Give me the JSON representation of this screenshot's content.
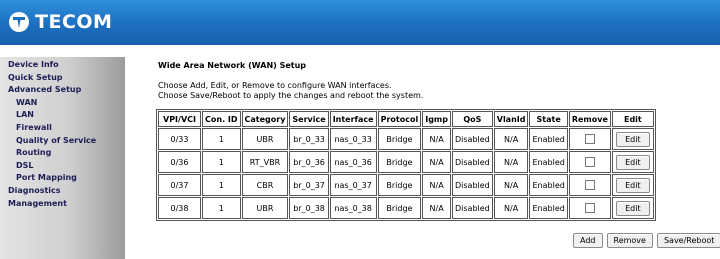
{
  "brand": {
    "name": "TECOM",
    "logo_icon": "tecom-logo-icon",
    "header_color": "#1d6fc0"
  },
  "sidebar": {
    "items": [
      {
        "label": "Device Info",
        "level": 1
      },
      {
        "label": "Quick Setup",
        "level": 1
      },
      {
        "label": "Advanced Setup",
        "level": 1
      },
      {
        "label": "WAN",
        "level": 2
      },
      {
        "label": "LAN",
        "level": 2
      },
      {
        "label": "Firewall",
        "level": 2
      },
      {
        "label": "Quality of Service",
        "level": 2
      },
      {
        "label": "Routing",
        "level": 2
      },
      {
        "label": "DSL",
        "level": 2
      },
      {
        "label": "Port Mapping",
        "level": 2
      },
      {
        "label": "Diagnostics",
        "level": 1
      },
      {
        "label": "Management",
        "level": 1
      }
    ]
  },
  "main": {
    "title": "Wide Area Network (WAN) Setup",
    "desc_line1": "Choose Add, Edit, or Remove to configure WAN interfaces.",
    "desc_line2": "Choose Save/Reboot to apply the changes and reboot the system.",
    "table": {
      "headers": [
        "VPI/VCI",
        "Con. ID",
        "Category",
        "Service",
        "Interface",
        "Protocol",
        "Igmp",
        "QoS",
        "VlanId",
        "State",
        "Remove",
        "Edit"
      ],
      "rows": [
        {
          "vpi_vci": "0/33",
          "con_id": "1",
          "category": "UBR",
          "service": "br_0_33",
          "interface": "nas_0_33",
          "protocol": "Bridge",
          "igmp": "N/A",
          "qos": "Disabled",
          "vlanid": "N/A",
          "state": "Enabled",
          "edit_label": "Edit"
        },
        {
          "vpi_vci": "0/36",
          "con_id": "1",
          "category": "RT_VBR",
          "service": "br_0_36",
          "interface": "nas_0_36",
          "protocol": "Bridge",
          "igmp": "N/A",
          "qos": "Disabled",
          "vlanid": "N/A",
          "state": "Enabled",
          "edit_label": "Edit"
        },
        {
          "vpi_vci": "0/37",
          "con_id": "1",
          "category": "CBR",
          "service": "br_0_37",
          "interface": "nas_0_37",
          "protocol": "Bridge",
          "igmp": "N/A",
          "qos": "Disabled",
          "vlanid": "N/A",
          "state": "Enabled",
          "edit_label": "Edit"
        },
        {
          "vpi_vci": "0/38",
          "con_id": "1",
          "category": "UBR",
          "service": "br_0_38",
          "interface": "nas_0_38",
          "protocol": "Bridge",
          "igmp": "N/A",
          "qos": "Disabled",
          "vlanid": "N/A",
          "state": "Enabled",
          "edit_label": "Edit"
        }
      ]
    },
    "buttons": {
      "add": "Add",
      "remove": "Remove",
      "save_reboot": "Save/Reboot"
    }
  }
}
